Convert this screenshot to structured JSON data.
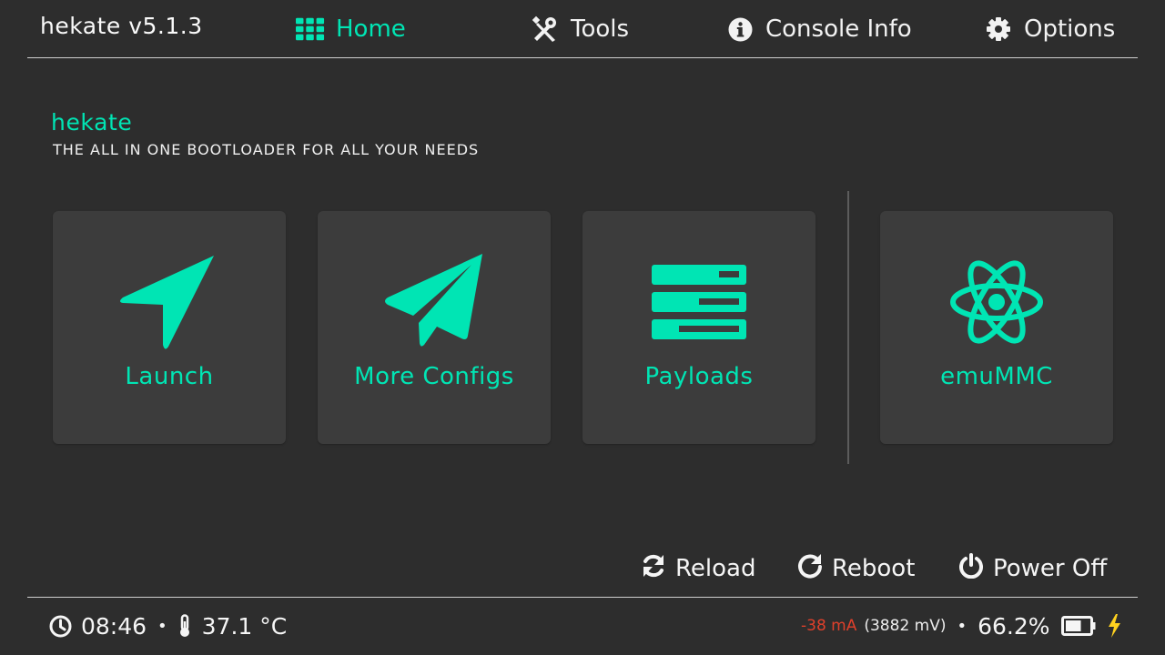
{
  "header": {
    "app_title": "hekate  v5.1.3",
    "nav": [
      {
        "label": "Home",
        "icon": "apps-icon",
        "active": true
      },
      {
        "label": "Tools",
        "icon": "tools-icon"
      },
      {
        "label": "Console Info",
        "icon": "info-icon"
      },
      {
        "label": "Options",
        "icon": "gear-icon"
      }
    ]
  },
  "main": {
    "title": "hekate",
    "subtitle": "THE ALL IN ONE BOOTLOADER FOR ALL YOUR NEEDS",
    "tiles": [
      {
        "label": "Launch",
        "icon": "navigation-arrow-icon"
      },
      {
        "label": "More Configs",
        "icon": "paper-plane-icon"
      },
      {
        "label": "Payloads",
        "icon": "server-stack-icon"
      },
      {
        "label": "emuMMC",
        "icon": "atom-icon"
      }
    ]
  },
  "actions": [
    {
      "label": "Reload",
      "icon": "refresh-icon"
    },
    {
      "label": "Reboot",
      "icon": "redo-icon"
    },
    {
      "label": "Power Off",
      "icon": "power-icon"
    }
  ],
  "status": {
    "time": "08:46",
    "temperature": "37.1 °C",
    "current": "-38 mA",
    "voltage": "(3882 mV)",
    "battery_percent": "66.2%",
    "battery_level": 0.662,
    "charging_icon": "lightning-icon"
  },
  "colors": {
    "accent": "#00e5b4",
    "background": "#2d2d2d",
    "tile": "#3c3c3c",
    "current": "#e0402b",
    "charging": "#ffd21f"
  }
}
